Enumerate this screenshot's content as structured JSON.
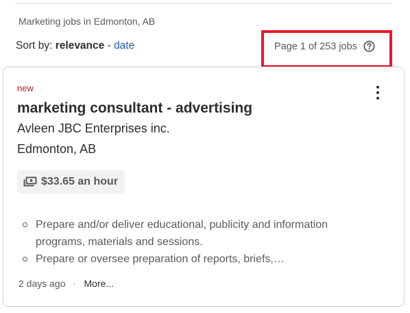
{
  "header": {
    "search_context": "Marketing jobs in Edmonton, AB",
    "sort_label": "Sort by:",
    "sort_current": "relevance",
    "sort_separator": "-",
    "sort_alternative": "date",
    "page_count": "Page 1 of 253 jobs",
    "help_icon": "question-circle-icon",
    "highlight_color": "#e8172c"
  },
  "job": {
    "badge": "new",
    "title": "marketing consultant - advertising",
    "company": "Avleen JBC Enterprises inc.",
    "location": "Edmonton, AB",
    "salary": "$33.65 an hour",
    "salary_icon": "money-icon",
    "menu_icon": "more-vertical-icon",
    "snippet": [
      "Prepare and/or deliver educational, publicity and information programs, materials and sessions.",
      "Prepare or oversee preparation of reports, briefs,…"
    ],
    "posted": "2 days ago",
    "footer_separator": "·",
    "more_label": "More..."
  },
  "colors": {
    "link": "#2557a7",
    "badge": "#a9252b",
    "text": "#2d2d2d",
    "muted": "#595959"
  }
}
